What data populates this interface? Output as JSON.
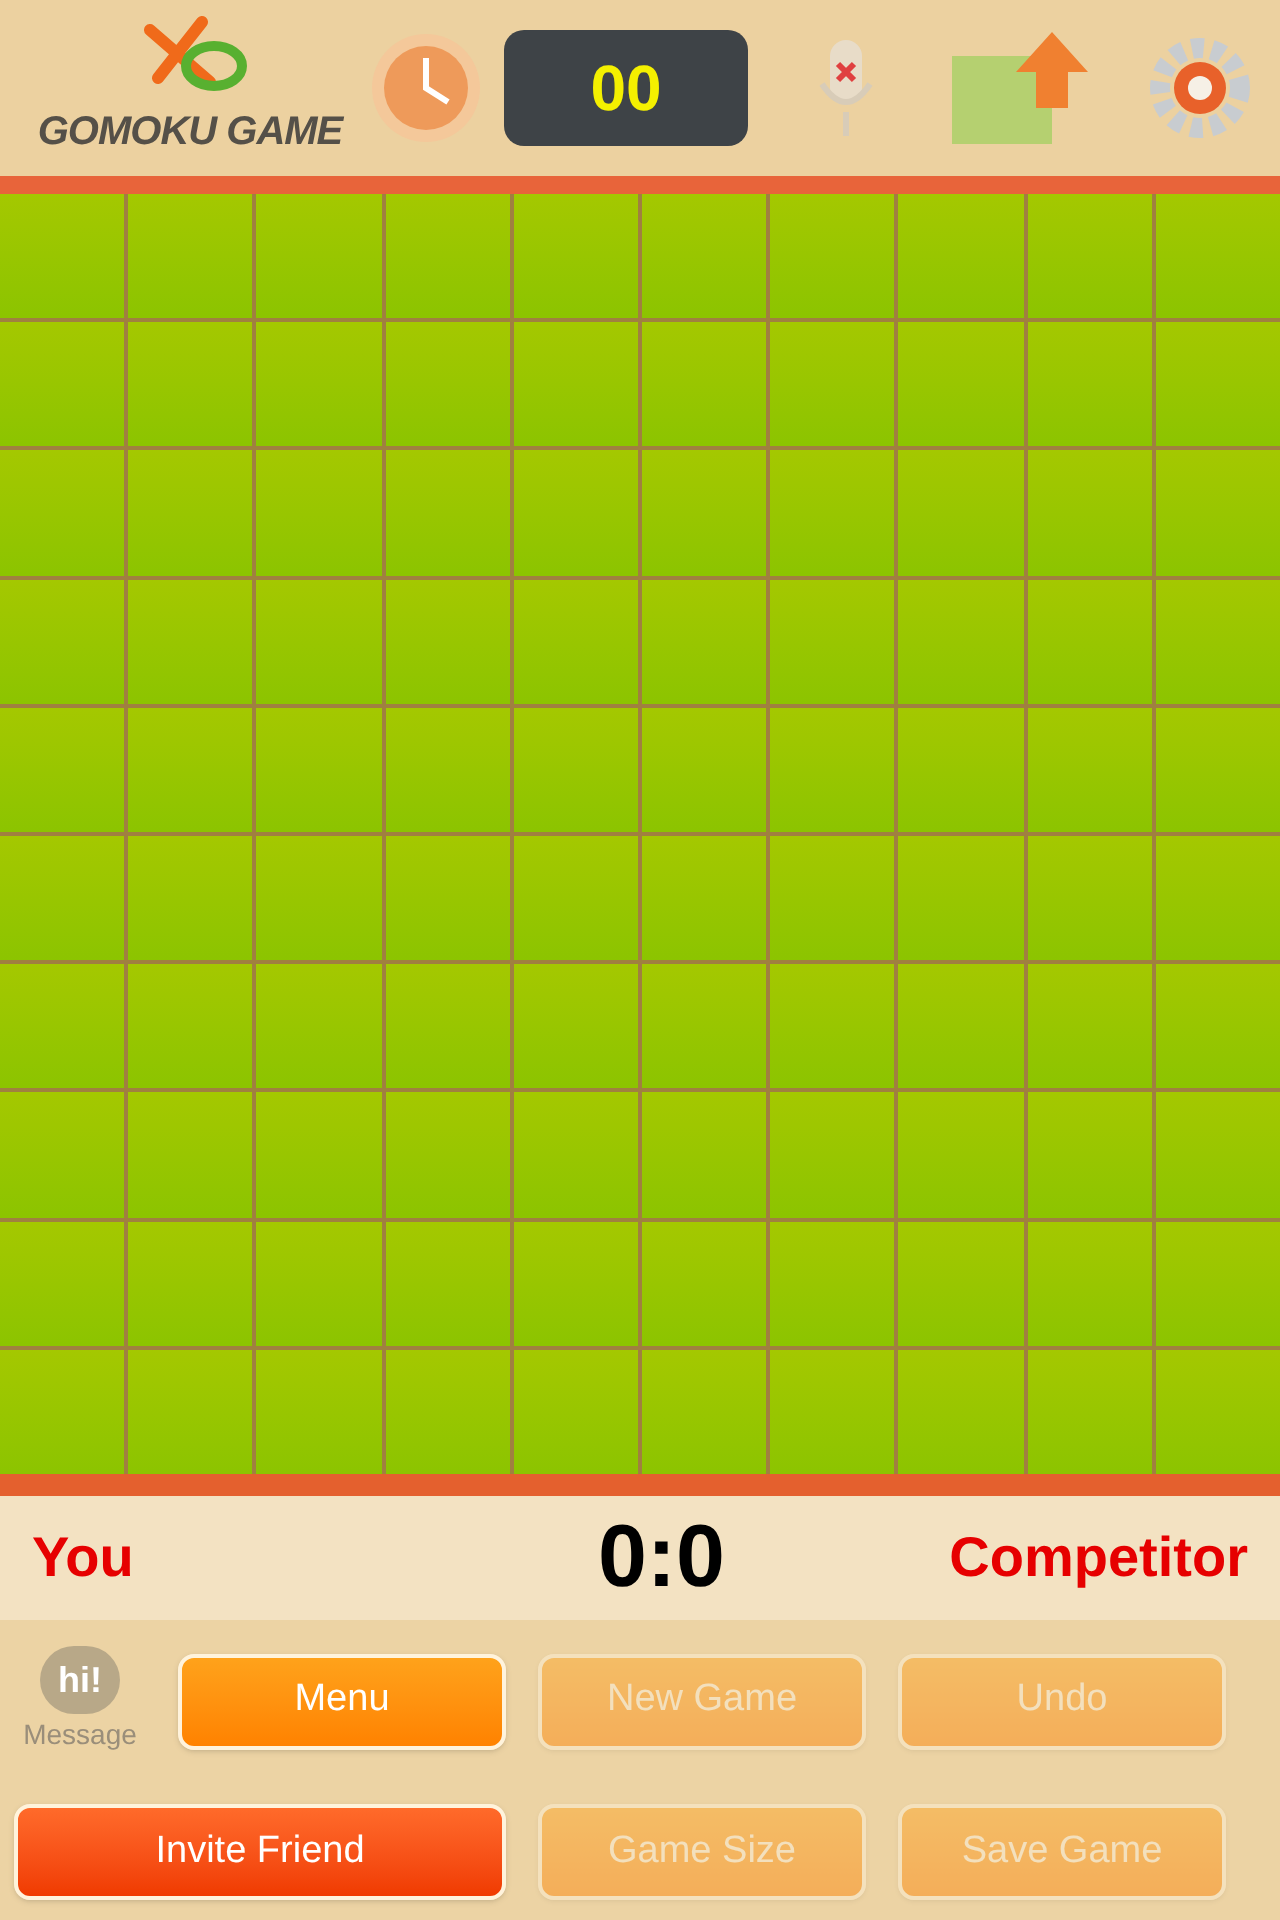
{
  "header": {
    "logo": "GOMOKU GAME",
    "timer": "00"
  },
  "score": {
    "player": "You",
    "result": "0:0",
    "opponent": "Competitor"
  },
  "message": {
    "bubble": "hi!",
    "label": "Message"
  },
  "buttons": [
    {
      "label": "Menu",
      "kind": "primary",
      "disabled": false
    },
    {
      "label": "New Game",
      "kind": "primary",
      "disabled": true
    },
    {
      "label": "Undo",
      "kind": "primary",
      "disabled": true
    },
    {
      "label": "Invite Friend",
      "kind": "accent",
      "disabled": false
    },
    {
      "label": "Game Size",
      "kind": "primary",
      "disabled": true
    },
    {
      "label": "Save Game",
      "kind": "primary",
      "disabled": true
    }
  ]
}
